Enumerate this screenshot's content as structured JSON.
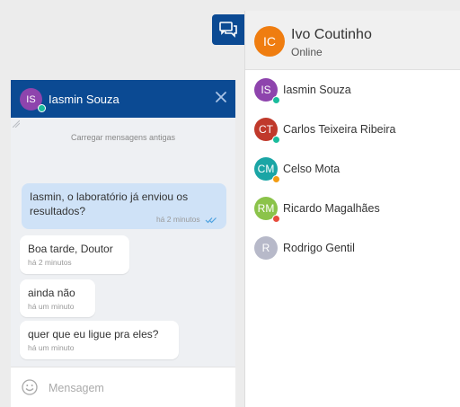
{
  "current_user": {
    "initials": "IC",
    "name": "Ivo Coutinho",
    "status": "Online",
    "color": "#ef7d10"
  },
  "contacts": [
    {
      "initials": "IS",
      "name": "Iasmin Souza",
      "color": "#8e44ad",
      "status_color": "#1abc9c"
    },
    {
      "initials": "CT",
      "name": "Carlos Teixeira Ribeira",
      "color": "#c0392b",
      "status_color": "#1abc9c"
    },
    {
      "initials": "CM",
      "name": "Celso Mota",
      "color": "#1aa5a5",
      "status_color": "#f39c12"
    },
    {
      "initials": "RM",
      "name": "Ricardo Magalhães",
      "color": "#8bc34a",
      "status_color": "#e74c3c"
    },
    {
      "initials": "R",
      "name": "Rodrigo Gentil",
      "color": "#b7b9c9",
      "status_color": ""
    }
  ],
  "chat": {
    "contact_initials": "IS",
    "contact_name": "Iasmin Souza",
    "contact_color": "#8e44ad",
    "contact_status_color": "#1abc9c",
    "load_more_label": "Carregar mensagens antigas",
    "messages": [
      {
        "text": "Iasmin, o laboratório já enviou os resultados?",
        "time": "há 2 minutos",
        "direction": "out"
      },
      {
        "text": "Boa tarde, Doutor",
        "time": "há 2 minutos",
        "direction": "in"
      },
      {
        "text": "ainda não",
        "time": "há um minuto",
        "direction": "in"
      },
      {
        "text": "quer que eu ligue pra eles?",
        "time": "há um minuto",
        "direction": "in"
      }
    ],
    "composer_placeholder": "Mensagem"
  },
  "colors": {
    "brand": "#0b4a93",
    "outgoing_bubble": "#cfe2f7",
    "read_ticks": "#4fa3e0"
  }
}
